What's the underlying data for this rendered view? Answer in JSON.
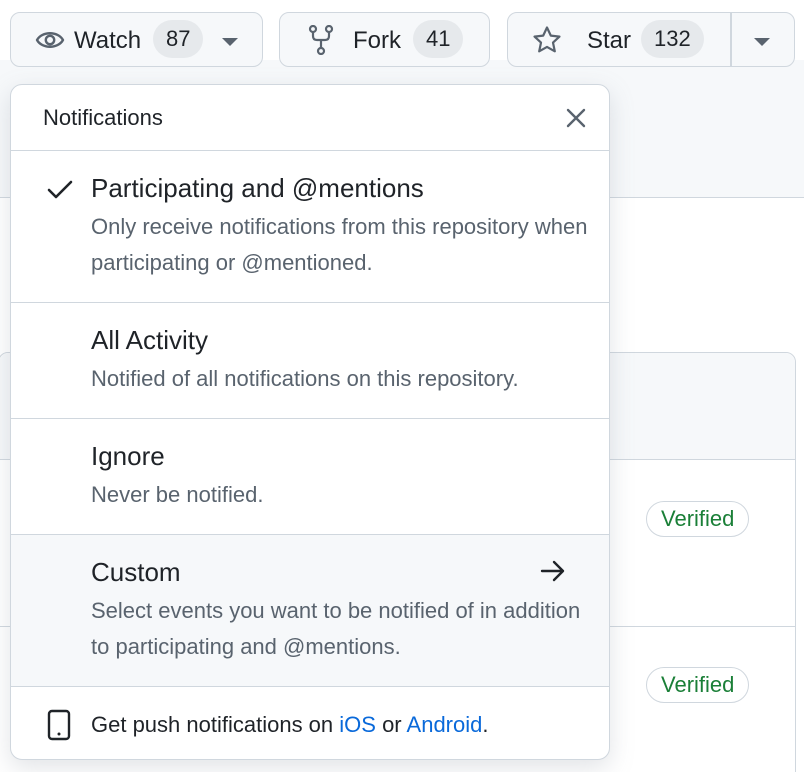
{
  "toolbar": {
    "watch": {
      "label": "Watch",
      "count": "87",
      "icon": "eye-icon"
    },
    "fork": {
      "label": "Fork",
      "count": "41",
      "icon": "repo-forked-icon"
    },
    "star": {
      "label": "Star",
      "count": "132",
      "icon": "star-icon"
    }
  },
  "notifications": {
    "title": "Notifications",
    "options": [
      {
        "title": "Participating and @mentions",
        "description": "Only receive notifications from this repository when participating or @mentioned.",
        "selected": true
      },
      {
        "title": "All Activity",
        "description": "Notified of all notifications on this repository.",
        "selected": false
      },
      {
        "title": "Ignore",
        "description": "Never be notified.",
        "selected": false
      },
      {
        "title": "Custom",
        "description": "Select events you want to be notified of in addition to participating and @mentions.",
        "selected": false,
        "icon": "arrow-right-icon"
      }
    ],
    "footer": {
      "prefix": "Get push notifications on ",
      "ios_link": "iOS",
      "middle": " or ",
      "android_link": "Android",
      "suffix": ".",
      "icon": "device-mobile-icon"
    }
  },
  "background": {
    "badges": [
      "Verified",
      "Verified"
    ]
  },
  "colors": {
    "link": "#0969da",
    "verified": "#1a7f37",
    "border": "#d0d7de",
    "muted_text": "#59636e",
    "hover_bg": "#f6f8fa"
  }
}
